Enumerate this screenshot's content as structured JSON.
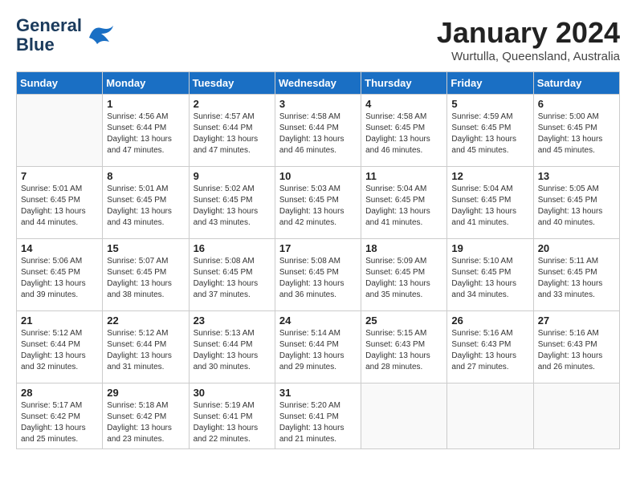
{
  "header": {
    "logo_line1": "General",
    "logo_line2": "Blue",
    "month_year": "January 2024",
    "location": "Wurtulla, Queensland, Australia"
  },
  "days_of_week": [
    "Sunday",
    "Monday",
    "Tuesday",
    "Wednesday",
    "Thursday",
    "Friday",
    "Saturday"
  ],
  "weeks": [
    [
      {
        "day": "",
        "empty": true
      },
      {
        "day": "1",
        "sunrise": "4:56 AM",
        "sunset": "6:44 PM",
        "daylight": "13 hours and 47 minutes."
      },
      {
        "day": "2",
        "sunrise": "4:57 AM",
        "sunset": "6:44 PM",
        "daylight": "13 hours and 47 minutes."
      },
      {
        "day": "3",
        "sunrise": "4:58 AM",
        "sunset": "6:44 PM",
        "daylight": "13 hours and 46 minutes."
      },
      {
        "day": "4",
        "sunrise": "4:58 AM",
        "sunset": "6:45 PM",
        "daylight": "13 hours and 46 minutes."
      },
      {
        "day": "5",
        "sunrise": "4:59 AM",
        "sunset": "6:45 PM",
        "daylight": "13 hours and 45 minutes."
      },
      {
        "day": "6",
        "sunrise": "5:00 AM",
        "sunset": "6:45 PM",
        "daylight": "13 hours and 45 minutes."
      }
    ],
    [
      {
        "day": "7",
        "sunrise": "5:01 AM",
        "sunset": "6:45 PM",
        "daylight": "13 hours and 44 minutes."
      },
      {
        "day": "8",
        "sunrise": "5:01 AM",
        "sunset": "6:45 PM",
        "daylight": "13 hours and 43 minutes."
      },
      {
        "day": "9",
        "sunrise": "5:02 AM",
        "sunset": "6:45 PM",
        "daylight": "13 hours and 43 minutes."
      },
      {
        "day": "10",
        "sunrise": "5:03 AM",
        "sunset": "6:45 PM",
        "daylight": "13 hours and 42 minutes."
      },
      {
        "day": "11",
        "sunrise": "5:04 AM",
        "sunset": "6:45 PM",
        "daylight": "13 hours and 41 minutes."
      },
      {
        "day": "12",
        "sunrise": "5:04 AM",
        "sunset": "6:45 PM",
        "daylight": "13 hours and 41 minutes."
      },
      {
        "day": "13",
        "sunrise": "5:05 AM",
        "sunset": "6:45 PM",
        "daylight": "13 hours and 40 minutes."
      }
    ],
    [
      {
        "day": "14",
        "sunrise": "5:06 AM",
        "sunset": "6:45 PM",
        "daylight": "13 hours and 39 minutes."
      },
      {
        "day": "15",
        "sunrise": "5:07 AM",
        "sunset": "6:45 PM",
        "daylight": "13 hours and 38 minutes."
      },
      {
        "day": "16",
        "sunrise": "5:08 AM",
        "sunset": "6:45 PM",
        "daylight": "13 hours and 37 minutes."
      },
      {
        "day": "17",
        "sunrise": "5:08 AM",
        "sunset": "6:45 PM",
        "daylight": "13 hours and 36 minutes."
      },
      {
        "day": "18",
        "sunrise": "5:09 AM",
        "sunset": "6:45 PM",
        "daylight": "13 hours and 35 minutes."
      },
      {
        "day": "19",
        "sunrise": "5:10 AM",
        "sunset": "6:45 PM",
        "daylight": "13 hours and 34 minutes."
      },
      {
        "day": "20",
        "sunrise": "5:11 AM",
        "sunset": "6:45 PM",
        "daylight": "13 hours and 33 minutes."
      }
    ],
    [
      {
        "day": "21",
        "sunrise": "5:12 AM",
        "sunset": "6:44 PM",
        "daylight": "13 hours and 32 minutes."
      },
      {
        "day": "22",
        "sunrise": "5:12 AM",
        "sunset": "6:44 PM",
        "daylight": "13 hours and 31 minutes."
      },
      {
        "day": "23",
        "sunrise": "5:13 AM",
        "sunset": "6:44 PM",
        "daylight": "13 hours and 30 minutes."
      },
      {
        "day": "24",
        "sunrise": "5:14 AM",
        "sunset": "6:44 PM",
        "daylight": "13 hours and 29 minutes."
      },
      {
        "day": "25",
        "sunrise": "5:15 AM",
        "sunset": "6:43 PM",
        "daylight": "13 hours and 28 minutes."
      },
      {
        "day": "26",
        "sunrise": "5:16 AM",
        "sunset": "6:43 PM",
        "daylight": "13 hours and 27 minutes."
      },
      {
        "day": "27",
        "sunrise": "5:16 AM",
        "sunset": "6:43 PM",
        "daylight": "13 hours and 26 minutes."
      }
    ],
    [
      {
        "day": "28",
        "sunrise": "5:17 AM",
        "sunset": "6:42 PM",
        "daylight": "13 hours and 25 minutes."
      },
      {
        "day": "29",
        "sunrise": "5:18 AM",
        "sunset": "6:42 PM",
        "daylight": "13 hours and 23 minutes."
      },
      {
        "day": "30",
        "sunrise": "5:19 AM",
        "sunset": "6:41 PM",
        "daylight": "13 hours and 22 minutes."
      },
      {
        "day": "31",
        "sunrise": "5:20 AM",
        "sunset": "6:41 PM",
        "daylight": "13 hours and 21 minutes."
      },
      {
        "day": "",
        "empty": true
      },
      {
        "day": "",
        "empty": true
      },
      {
        "day": "",
        "empty": true
      }
    ]
  ]
}
